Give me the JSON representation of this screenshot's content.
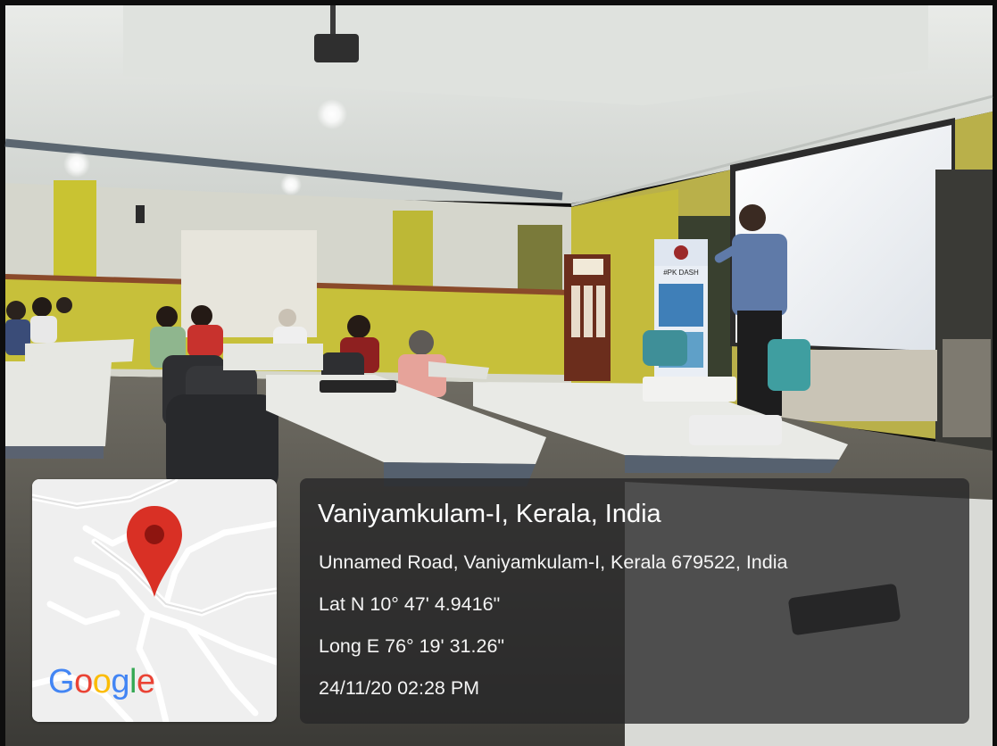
{
  "photo": {
    "subject": "seminar-room-with-presenter",
    "banner_text": "#PK DASH"
  },
  "map": {
    "pin_color": "#d93025",
    "pin_dot_color": "#8e1510",
    "brand": "Google",
    "brand_letters": [
      {
        "ch": "G",
        "color": "#4285f4"
      },
      {
        "ch": "o",
        "color": "#ea4335"
      },
      {
        "ch": "o",
        "color": "#fbbc05"
      },
      {
        "ch": "g",
        "color": "#4285f4"
      },
      {
        "ch": "l",
        "color": "#34a853"
      },
      {
        "ch": "e",
        "color": "#ea4335"
      }
    ]
  },
  "location": {
    "title": "Vaniyamkulam-I, Kerala, India",
    "address": "Unnamed Road, Vaniyamkulam-I, Kerala 679522, India",
    "latitude": "Lat N 10° 47' 4.9416\"",
    "longitude": "Long E 76° 19' 31.26\"",
    "datetime": "24/11/20 02:28 PM"
  }
}
